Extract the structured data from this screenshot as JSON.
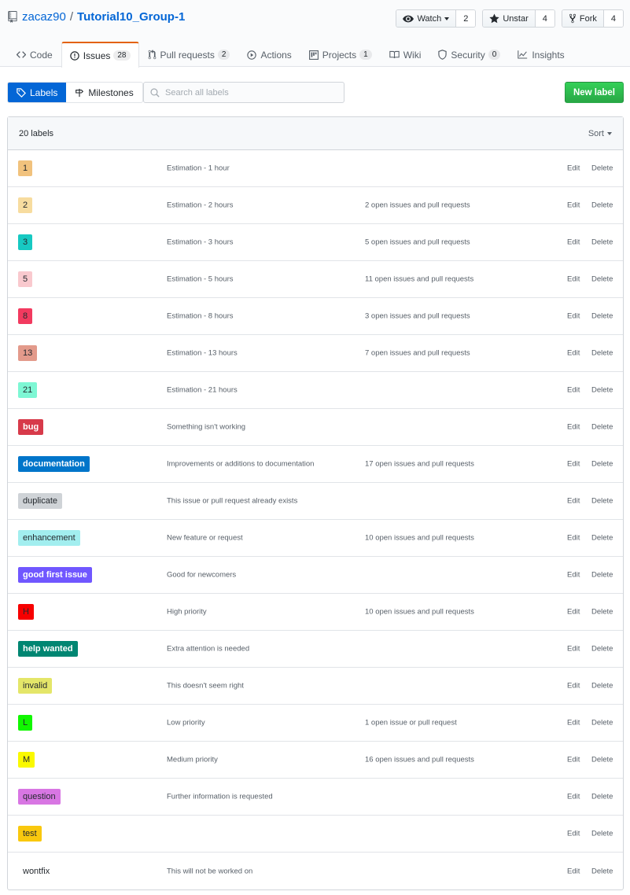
{
  "repo": {
    "owner": "zacaz90",
    "separator": "/",
    "name": "Tutorial10_Group-1"
  },
  "actions": {
    "watch": {
      "label": "Watch",
      "count": "2"
    },
    "unstar": {
      "label": "Unstar",
      "count": "4"
    },
    "fork": {
      "label": "Fork",
      "count": "4"
    }
  },
  "tabs": {
    "code": {
      "label": "Code"
    },
    "issues": {
      "label": "Issues",
      "count": "28"
    },
    "pulls": {
      "label": "Pull requests",
      "count": "2"
    },
    "actions": {
      "label": "Actions"
    },
    "projects": {
      "label": "Projects",
      "count": "1"
    },
    "wiki": {
      "label": "Wiki"
    },
    "security": {
      "label": "Security",
      "count": "0"
    },
    "insights": {
      "label": "Insights"
    }
  },
  "subnav": {
    "labels": "Labels",
    "milestones": "Milestones"
  },
  "search": {
    "placeholder": "Search all labels",
    "value": ""
  },
  "new_label": "New label",
  "box": {
    "count": "20 labels",
    "sort": "Sort"
  },
  "row_actions": {
    "edit": "Edit",
    "delete": "Delete"
  },
  "labels": [
    {
      "name": "1",
      "bg": "#f1c27d",
      "fg": "#24292e",
      "desc": "Estimation - 1 hour",
      "issues": ""
    },
    {
      "name": "2",
      "bg": "#f7dc9f",
      "fg": "#24292e",
      "desc": "Estimation - 2 hours",
      "issues": "2 open issues and pull requests"
    },
    {
      "name": "3",
      "bg": "#17c9c2",
      "fg": "#24292e",
      "desc": "Estimation - 3 hours",
      "issues": "5 open issues and pull requests"
    },
    {
      "name": "5",
      "bg": "#f9c9ce",
      "fg": "#24292e",
      "desc": "Estimation - 5 hours",
      "issues": "11 open issues and pull requests"
    },
    {
      "name": "8",
      "bg": "#f23a5f",
      "fg": "#24292e",
      "desc": "Estimation - 8 hours",
      "issues": "3 open issues and pull requests"
    },
    {
      "name": "13",
      "bg": "#e39a8b",
      "fg": "#24292e",
      "desc": "Estimation - 13 hours",
      "issues": "7 open issues and pull requests"
    },
    {
      "name": "21",
      "bg": "#7ef7d4",
      "fg": "#24292e",
      "desc": "Estimation - 21 hours",
      "issues": ""
    },
    {
      "name": "bug",
      "bg": "#d73a4a",
      "fg": "#ffffff",
      "desc": "Something isn't working",
      "issues": ""
    },
    {
      "name": "documentation",
      "bg": "#0075ca",
      "fg": "#ffffff",
      "desc": "Improvements or additions to documentation",
      "issues": "17 open issues and pull requests"
    },
    {
      "name": "duplicate",
      "bg": "#cfd3d7",
      "fg": "#24292e",
      "desc": "This issue or pull request already exists",
      "issues": ""
    },
    {
      "name": "enhancement",
      "bg": "#a2eeef",
      "fg": "#24292e",
      "desc": "New feature or request",
      "issues": "10 open issues and pull requests"
    },
    {
      "name": "good first issue",
      "bg": "#7057ff",
      "fg": "#ffffff",
      "desc": "Good for newcomers",
      "issues": ""
    },
    {
      "name": "H",
      "bg": "#f70000",
      "fg": "#24292e",
      "desc": "High priority",
      "issues": "10 open issues and pull requests"
    },
    {
      "name": "help wanted",
      "bg": "#008672",
      "fg": "#ffffff",
      "desc": "Extra attention is needed",
      "issues": ""
    },
    {
      "name": "invalid",
      "bg": "#e4e669",
      "fg": "#24292e",
      "desc": "This doesn't seem right",
      "issues": ""
    },
    {
      "name": "L",
      "bg": "#11f700",
      "fg": "#24292e",
      "desc": "Low priority",
      "issues": "1 open issue or pull request"
    },
    {
      "name": "M",
      "bg": "#faf900",
      "fg": "#24292e",
      "desc": "Medium priority",
      "issues": "16 open issues and pull requests"
    },
    {
      "name": "question",
      "bg": "#d876e3",
      "fg": "#24292e",
      "desc": "Further information is requested",
      "issues": ""
    },
    {
      "name": "test",
      "bg": "#f9c80e",
      "fg": "#24292e",
      "desc": "",
      "issues": ""
    },
    {
      "name": "wontfix",
      "bg": "#ffffff",
      "fg": "#24292e",
      "desc": "This will not be worked on",
      "issues": ""
    }
  ]
}
